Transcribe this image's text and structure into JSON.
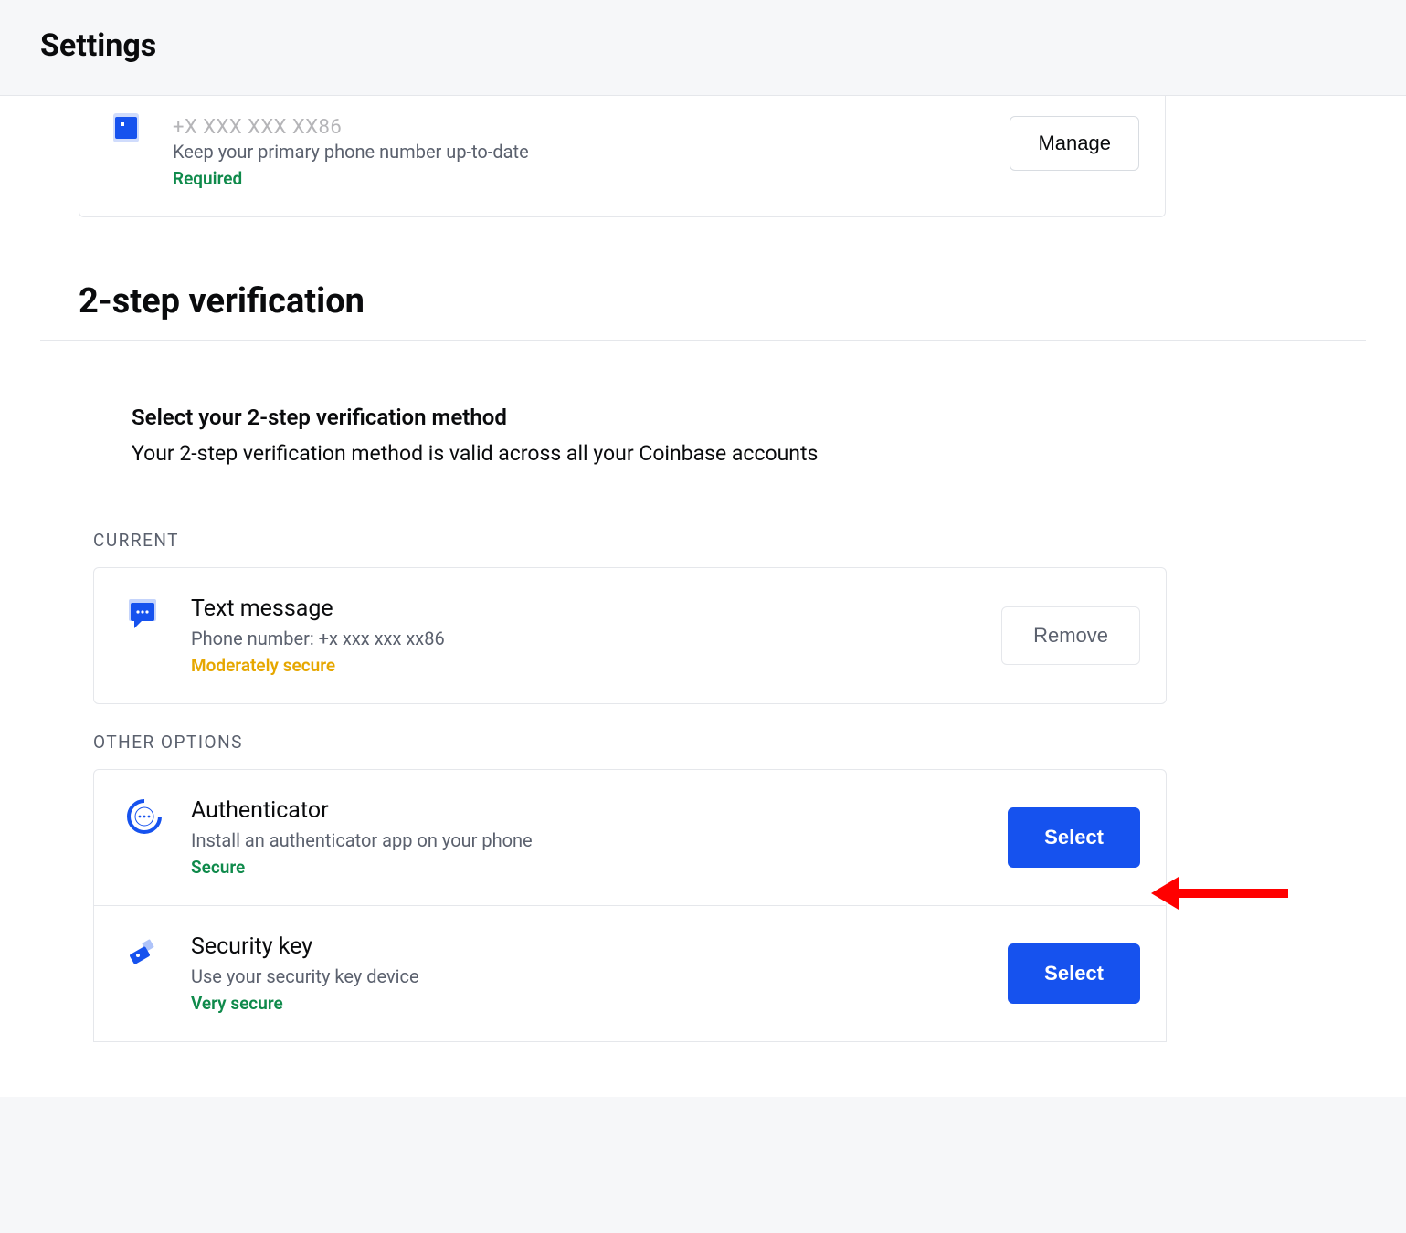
{
  "header": {
    "title": "Settings"
  },
  "phone": {
    "masked": "+X XXX XXX XX86",
    "description": "Keep your primary phone number up-to-date",
    "required_label": "Required",
    "manage_label": "Manage"
  },
  "twostep": {
    "heading": "2-step verification",
    "select_title": "Select your 2-step verification method",
    "select_desc": "Your 2-step verification method is valid across all your Coinbase accounts",
    "current_label": "CURRENT",
    "other_label": "OTHER OPTIONS",
    "current": {
      "title": "Text message",
      "detail": "Phone number: +x xxx xxx xx86",
      "security": "Moderately secure",
      "action": "Remove"
    },
    "options": [
      {
        "title": "Authenticator",
        "detail": "Install an authenticator app on your phone",
        "security": "Secure",
        "action": "Select"
      },
      {
        "title": "Security key",
        "detail": "Use your security key device",
        "security": "Very secure",
        "action": "Select"
      }
    ]
  }
}
